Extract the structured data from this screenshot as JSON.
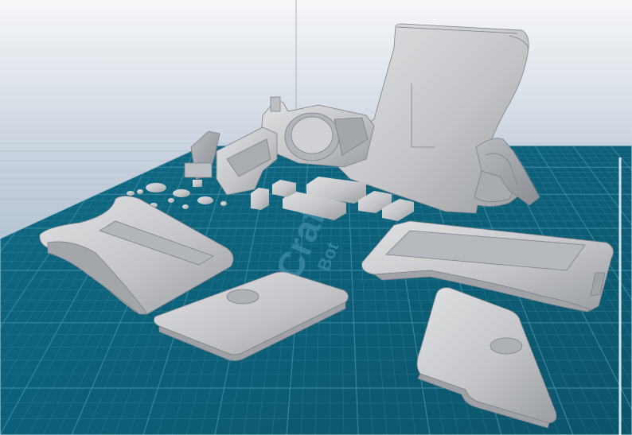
{
  "viewport": {
    "background_top_color": "#f6f7f9",
    "background_horizon_color": "#c9d3de",
    "background_bottom_color": "#8ea3bb",
    "platform_color": "#0f5f77",
    "platform_grid_color": "#3a8aa3",
    "model_color": "#c4c6c9"
  },
  "build_plate": {
    "watermark_main": "Craft",
    "watermark_sub": "Bot"
  },
  "model": {
    "parts": [
      "frame-body-part",
      "barrel-part",
      "hammer-part",
      "trigger-assembly-part",
      "left-grip-panel-part",
      "right-grip-panel-part",
      "small-plate-left-part",
      "small-plate-right-part",
      "small-pins-parts"
    ]
  }
}
